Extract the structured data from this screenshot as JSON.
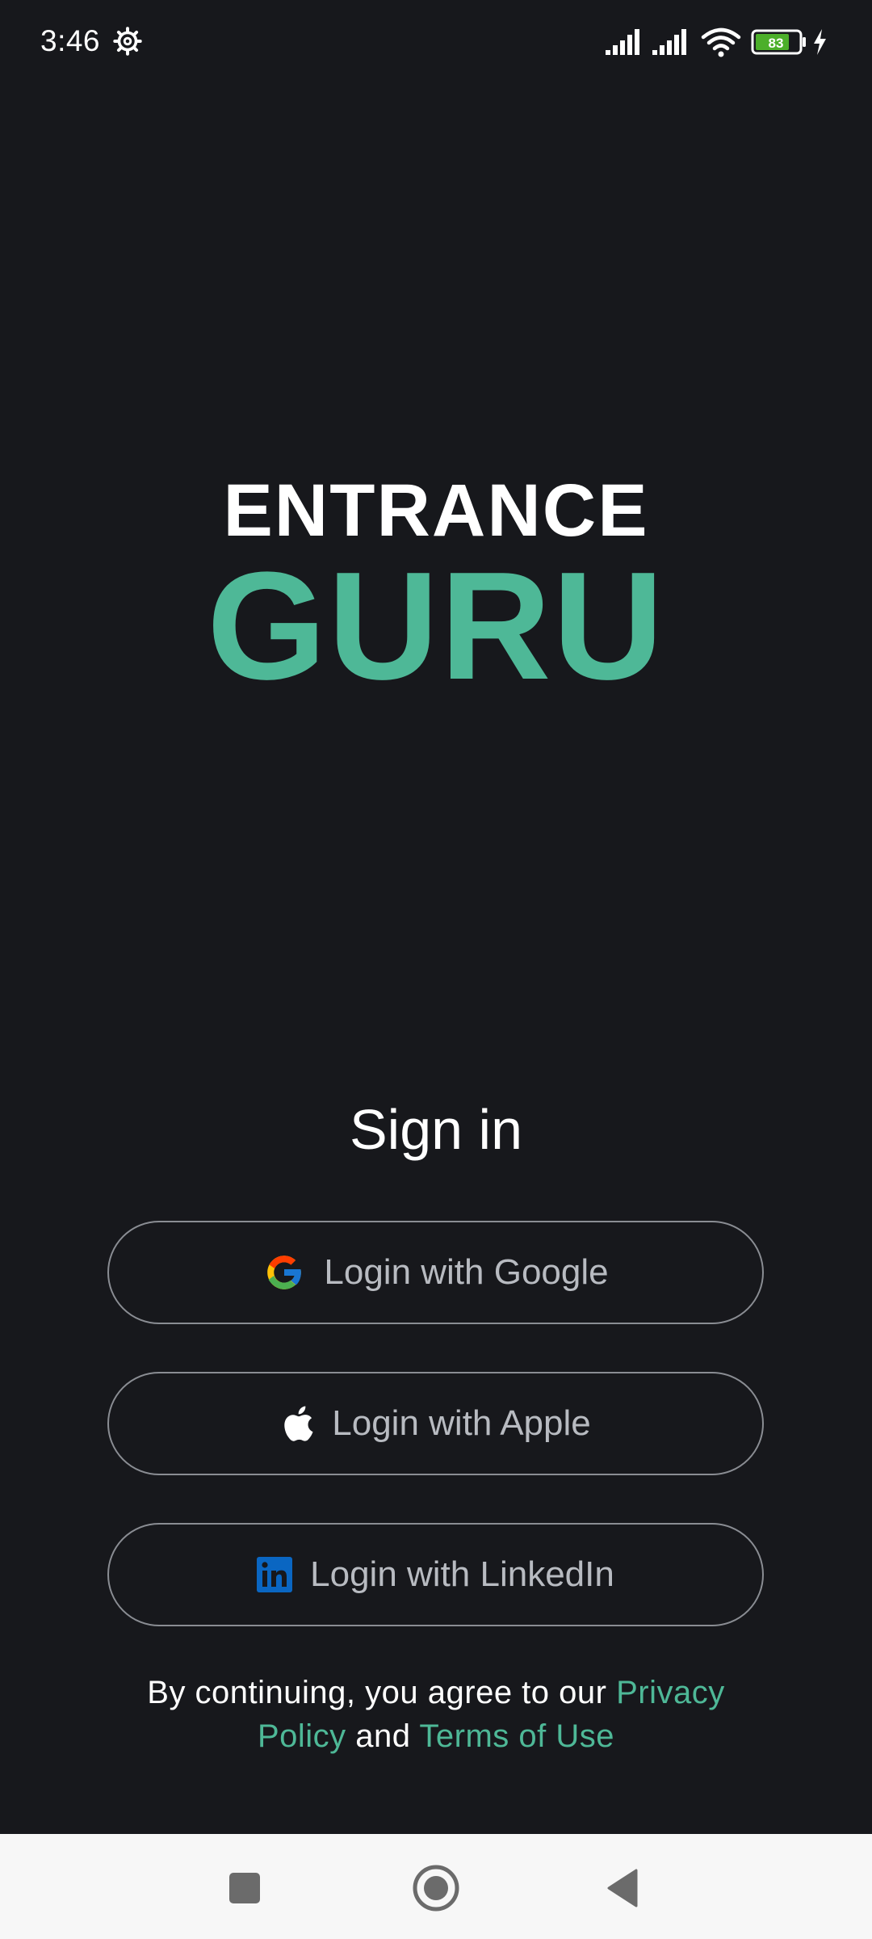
{
  "status_bar": {
    "time": "3:46",
    "battery_level": "83",
    "icons": [
      "gear-icon",
      "signal-icon",
      "signal-icon",
      "wifi-icon",
      "battery-icon",
      "charging-icon"
    ]
  },
  "logo": {
    "line1": "ENTRANCE",
    "line2": "GURU"
  },
  "signin": {
    "title": "Sign in",
    "google_label": "Login with Google",
    "apple_label": "Login with Apple",
    "linkedin_label": "Login with LinkedIn"
  },
  "legal": {
    "prefix": "By continuing, you agree to our ",
    "privacy_link": "Privacy Policy",
    "middle": " and ",
    "terms_link": "Terms of Use"
  },
  "colors": {
    "background": "#17181c",
    "accent": "#4eb897",
    "button_border": "#8a8d93",
    "button_text": "#b8bbc1",
    "nav_bar": "#f7f7f7"
  },
  "nav_bar": {
    "icons": [
      "recents-icon",
      "home-icon",
      "back-icon"
    ]
  }
}
